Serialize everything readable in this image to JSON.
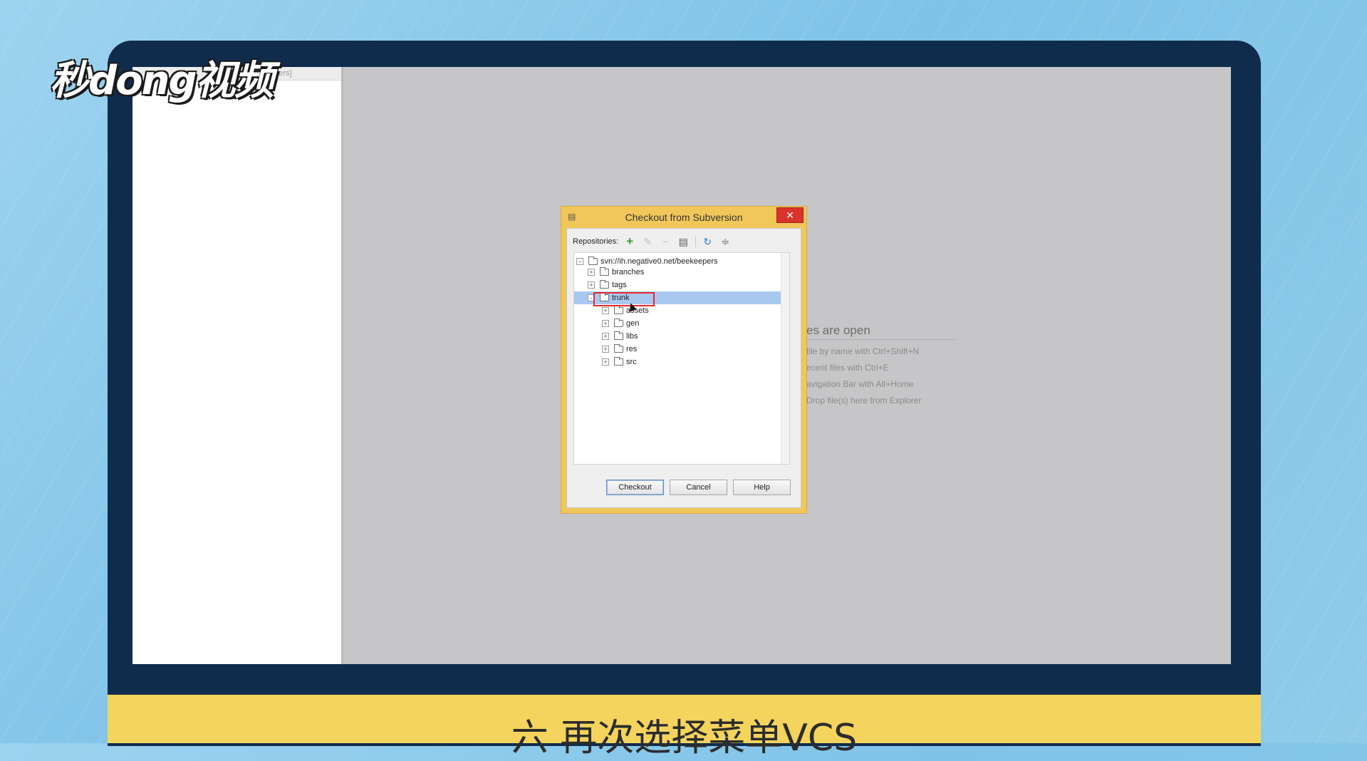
{
  "watermark": {
    "logo_text": "秒dong视频"
  },
  "ide": {
    "left_panel_header": "[beekeepers]",
    "empty_state": {
      "title": "es are open",
      "hints": [
        "file by name with Ctrl+Shift+N",
        "ecent files with Ctrl+E",
        "avigation Bar with Alt+Home",
        "Drop file(s) here from Explorer"
      ]
    }
  },
  "dialog": {
    "title": "Checkout from Subversion",
    "close_glyph": "✕",
    "toolbar": {
      "label": "Repositories:",
      "icons": [
        "add-icon",
        "edit-icon",
        "remove-icon",
        "browse-icon",
        "refresh-icon",
        "collapse-icon"
      ]
    },
    "tree": {
      "root": "svn://ih.negative0.net/beekeepers",
      "items": [
        {
          "label": "branches",
          "level": 1,
          "expander": "+"
        },
        {
          "label": "tags",
          "level": 1,
          "expander": "+"
        },
        {
          "label": "trunk",
          "level": 1,
          "expander": "-",
          "selected": true
        },
        {
          "label": "assets",
          "level": 2,
          "expander": "+"
        },
        {
          "label": "gen",
          "level": 2,
          "expander": "+"
        },
        {
          "label": "libs",
          "level": 2,
          "expander": "+"
        },
        {
          "label": "res",
          "level": 2,
          "expander": "+"
        },
        {
          "label": "src",
          "level": 2,
          "expander": "+"
        }
      ]
    },
    "buttons": {
      "checkout": "Checkout",
      "cancel": "Cancel",
      "help": "Help"
    }
  },
  "subtitle": "六 再次选择菜单VCS",
  "colors": {
    "selection": "#a9c8ef",
    "highlight": "#e8272d",
    "dialog_frame": "#f1c75a",
    "banner": "#f4d45d"
  }
}
